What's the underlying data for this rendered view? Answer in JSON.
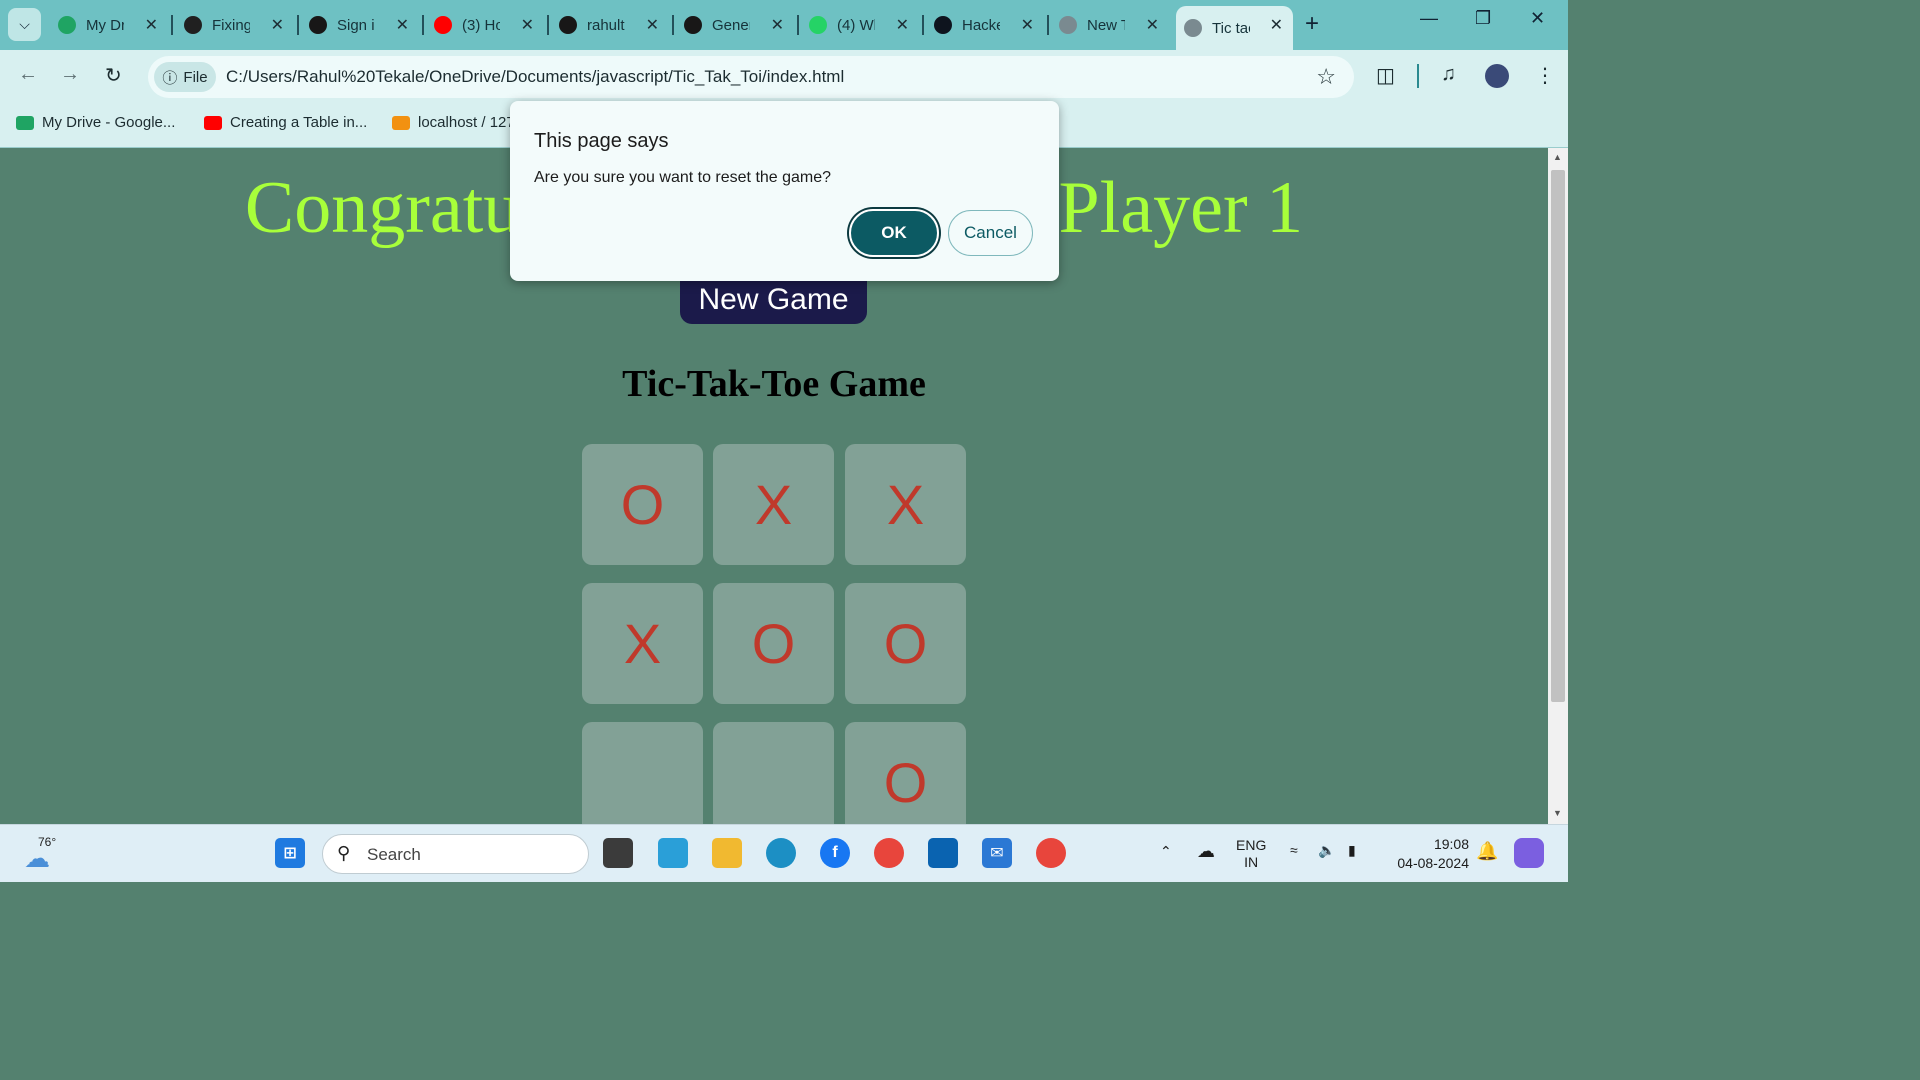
{
  "browser": {
    "tabs": [
      {
        "title": "My Dr",
        "icon": "google-drive-icon",
        "color": "#1fa463",
        "active": false
      },
      {
        "title": "Fixing",
        "icon": "openai-icon",
        "color": "#202020",
        "active": false
      },
      {
        "title": "Sign i",
        "icon": "github-icon",
        "color": "#181717",
        "active": false
      },
      {
        "title": "(3) Ho",
        "icon": "youtube-icon",
        "color": "#ff0000",
        "active": false
      },
      {
        "title": "rahult",
        "icon": "github-icon",
        "color": "#181717",
        "active": false
      },
      {
        "title": "Gener",
        "icon": "github-icon",
        "color": "#181717",
        "active": false
      },
      {
        "title": "(4) Wh",
        "icon": "whatsapp-icon",
        "color": "#25d366",
        "active": false
      },
      {
        "title": "Hacke",
        "icon": "hackerrank-icon",
        "color": "#0e141e",
        "active": false
      },
      {
        "title": "New T",
        "icon": "globe-icon",
        "color": "#7a8a90",
        "active": false
      },
      {
        "title": "Tic tac",
        "icon": "globe-icon",
        "color": "#7a8a90",
        "active": true
      }
    ],
    "url_chip": "File",
    "url": "C:/Users/Rahul%20Tekale/OneDrive/Documents/javascript/Tic_Tak_Toi/index.html",
    "bookmarks": [
      {
        "label": "My Drive - Google...",
        "icon": "google-drive-icon",
        "color": "#1fa463"
      },
      {
        "label": "Creating a Table in...",
        "icon": "youtube-icon",
        "color": "#ff0000"
      },
      {
        "label": "localhost / 127",
        "icon": "phpmyadmin-icon",
        "color": "#f29111"
      }
    ]
  },
  "game": {
    "message": "Congratulations, Winner is Player 1",
    "new_game_label": "New Game",
    "heading": "Tic-Tak-Toe Game",
    "cells": [
      "O",
      "X",
      "X",
      "X",
      "O",
      "O",
      "",
      "",
      "O"
    ],
    "mark_color": "#c0392b"
  },
  "dialog": {
    "title": "This page says",
    "message": "Are you sure you want to reset the game?",
    "ok_label": "OK",
    "cancel_label": "Cancel"
  },
  "taskbar": {
    "weather": "76°",
    "search_placeholder": "Search",
    "lang_top": "ENG",
    "lang_bottom": "IN",
    "time": "19:08",
    "date": "04-08-2024"
  }
}
